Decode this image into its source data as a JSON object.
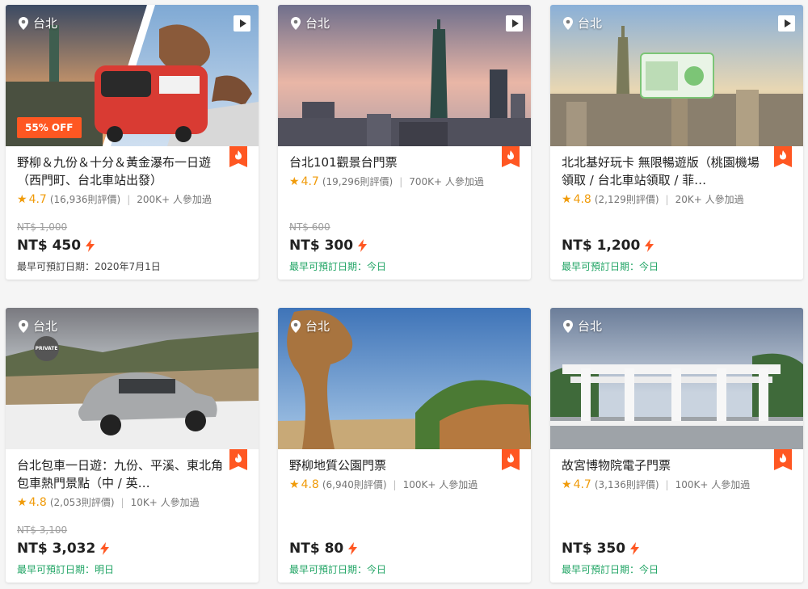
{
  "cards": [
    {
      "location": "台北",
      "title": "野柳＆九份＆十分＆黃金瀑布一日遊（西門町、台北車站出發）",
      "rating": "4.7",
      "reviews": "(16,936則評價)",
      "participants": "200K+ 人參加過",
      "old_price": "NT$ 1,000",
      "price": "NT$ 450",
      "availability": "最早可預訂日期：2020年7月1日",
      "discount": "55% OFF",
      "has_video": true
    },
    {
      "location": "台北",
      "title": "台北101觀景台門票",
      "rating": "4.7",
      "reviews": "(19,296則評價)",
      "participants": "700K+ 人參加過",
      "old_price": "NT$ 600",
      "price": "NT$ 300",
      "availability": "最早可預訂日期：今日",
      "has_video": true
    },
    {
      "location": "台北",
      "title": "北北基好玩卡 無限暢遊版（桃園機場領取 / 台北車站領取 / 菲…",
      "rating": "4.8",
      "reviews": "(2,129則評價)",
      "participants": "20K+ 人參加過",
      "old_price": "",
      "price": "NT$ 1,200",
      "availability": "最早可預訂日期：今日",
      "has_video": true
    },
    {
      "location": "台北",
      "title": "台北包車一日遊：九份、平溪、東北角包車熱門景點（中 / 英…",
      "rating": "4.8",
      "reviews": "(2,053則評價)",
      "participants": "10K+ 人參加過",
      "old_price": "NT$ 3,100",
      "price": "NT$ 3,032",
      "availability": "最早可預訂日期：明日",
      "badge": "PRIVATE"
    },
    {
      "location": "台北",
      "title": "野柳地質公園門票",
      "rating": "4.8",
      "reviews": "(6,940則評價)",
      "participants": "100K+ 人參加過",
      "old_price": "",
      "price": "NT$ 80",
      "availability": "最早可預訂日期：今日"
    },
    {
      "location": "台北",
      "title": "故宮博物院電子門票",
      "rating": "4.7",
      "reviews": "(3,136則評價)",
      "participants": "100K+ 人參加過",
      "old_price": "",
      "price": "NT$ 350",
      "availability": "最早可預訂日期：今日"
    }
  ],
  "colors": {
    "accent": "#ff5722",
    "star": "#f09b0a",
    "available": "#20a464"
  }
}
